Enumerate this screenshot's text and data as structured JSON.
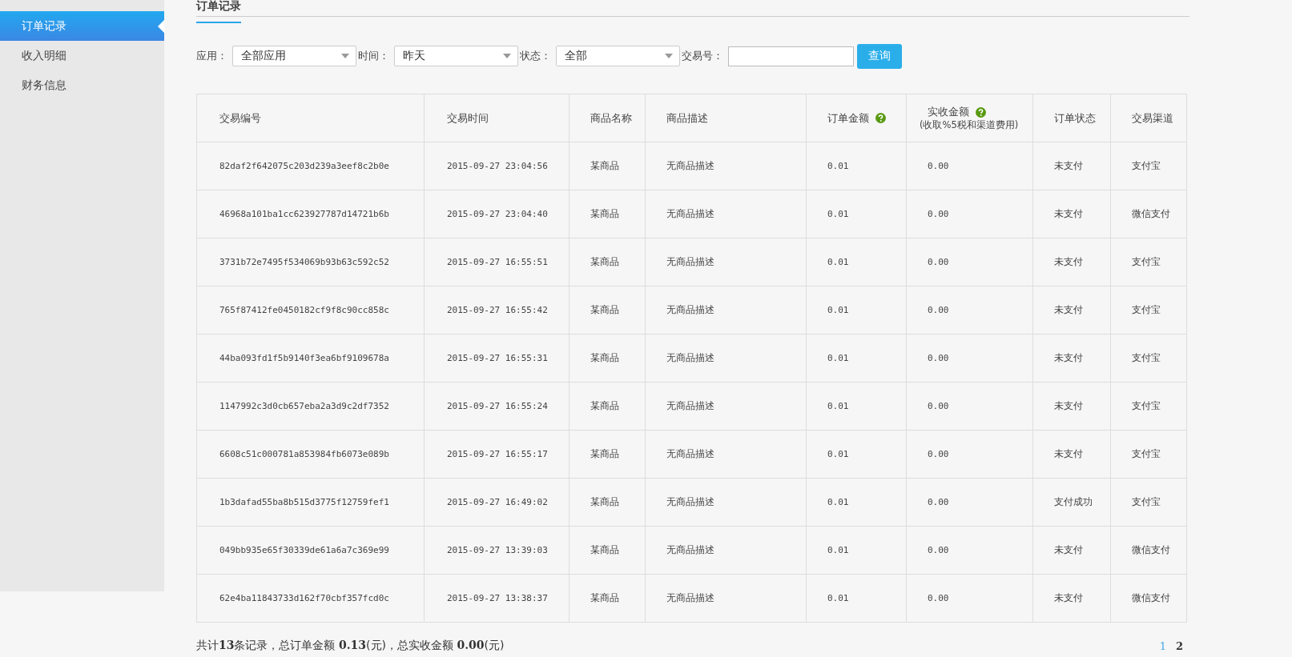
{
  "sidebar": {
    "items": [
      {
        "label": "订单记录",
        "selected": true
      },
      {
        "label": "收入明细",
        "selected": false
      },
      {
        "label": "财务信息",
        "selected": false
      }
    ]
  },
  "heading": "订单记录",
  "filters": {
    "app": {
      "label": "应用：",
      "value": "全部应用"
    },
    "time": {
      "label": "时间：",
      "value": "昨天"
    },
    "status": {
      "label": "状态：",
      "value": "全部"
    },
    "trade_no": {
      "label": "交易号："
    },
    "query_button": "查询"
  },
  "table": {
    "columns": [
      {
        "label": "交易编号"
      },
      {
        "label": "交易时间"
      },
      {
        "label": "商品名称"
      },
      {
        "label": "商品描述"
      },
      {
        "label": "订单金额",
        "help": true
      },
      {
        "label": "实收金额",
        "sublabel": "(收取%5税和渠道费用)",
        "help": true
      },
      {
        "label": "订单状态"
      },
      {
        "label": "交易渠道"
      }
    ],
    "rows": [
      [
        "82daf2f642075c203d239a3eef8c2b0e",
        "2015-09-27 23:04:56",
        "某商品",
        "无商品描述",
        "0.01",
        "0.00",
        "未支付",
        "支付宝"
      ],
      [
        "46968a101ba1cc623927787d14721b6b",
        "2015-09-27 23:04:40",
        "某商品",
        "无商品描述",
        "0.01",
        "0.00",
        "未支付",
        "微信支付"
      ],
      [
        "3731b72e7495f534069b93b63c592c52",
        "2015-09-27 16:55:51",
        "某商品",
        "无商品描述",
        "0.01",
        "0.00",
        "未支付",
        "支付宝"
      ],
      [
        "765f87412fe0450182cf9f8c90cc858c",
        "2015-09-27 16:55:42",
        "某商品",
        "无商品描述",
        "0.01",
        "0.00",
        "未支付",
        "支付宝"
      ],
      [
        "44ba093fd1f5b9140f3ea6bf9109678a",
        "2015-09-27 16:55:31",
        "某商品",
        "无商品描述",
        "0.01",
        "0.00",
        "未支付",
        "支付宝"
      ],
      [
        "1147992c3d0cb657eba2a3d9c2df7352",
        "2015-09-27 16:55:24",
        "某商品",
        "无商品描述",
        "0.01",
        "0.00",
        "未支付",
        "支付宝"
      ],
      [
        "6608c51c000781a853984fb6073e089b",
        "2015-09-27 16:55:17",
        "某商品",
        "无商品描述",
        "0.01",
        "0.00",
        "未支付",
        "支付宝"
      ],
      [
        "1b3dafad55ba8b515d3775f12759fef1",
        "2015-09-27 16:49:02",
        "某商品",
        "无商品描述",
        "0.01",
        "0.00",
        "支付成功",
        "支付宝"
      ],
      [
        "049bb935e65f30339de61a6a7c369e99",
        "2015-09-27 13:39:03",
        "某商品",
        "无商品描述",
        "0.01",
        "0.00",
        "未支付",
        "微信支付"
      ],
      [
        "62e4ba11843733d162f70cbf357fcd0c",
        "2015-09-27 13:38:37",
        "某商品",
        "无商品描述",
        "0.01",
        "0.00",
        "未支付",
        "微信支付"
      ]
    ]
  },
  "summary": "共计**13**条记录，总订单金额 **0.13**(元)，总实收金额 **0.00**(元)",
  "pagination": [
    {
      "label": "1",
      "selected": true
    },
    {
      "label": "2",
      "selected": false
    }
  ]
}
